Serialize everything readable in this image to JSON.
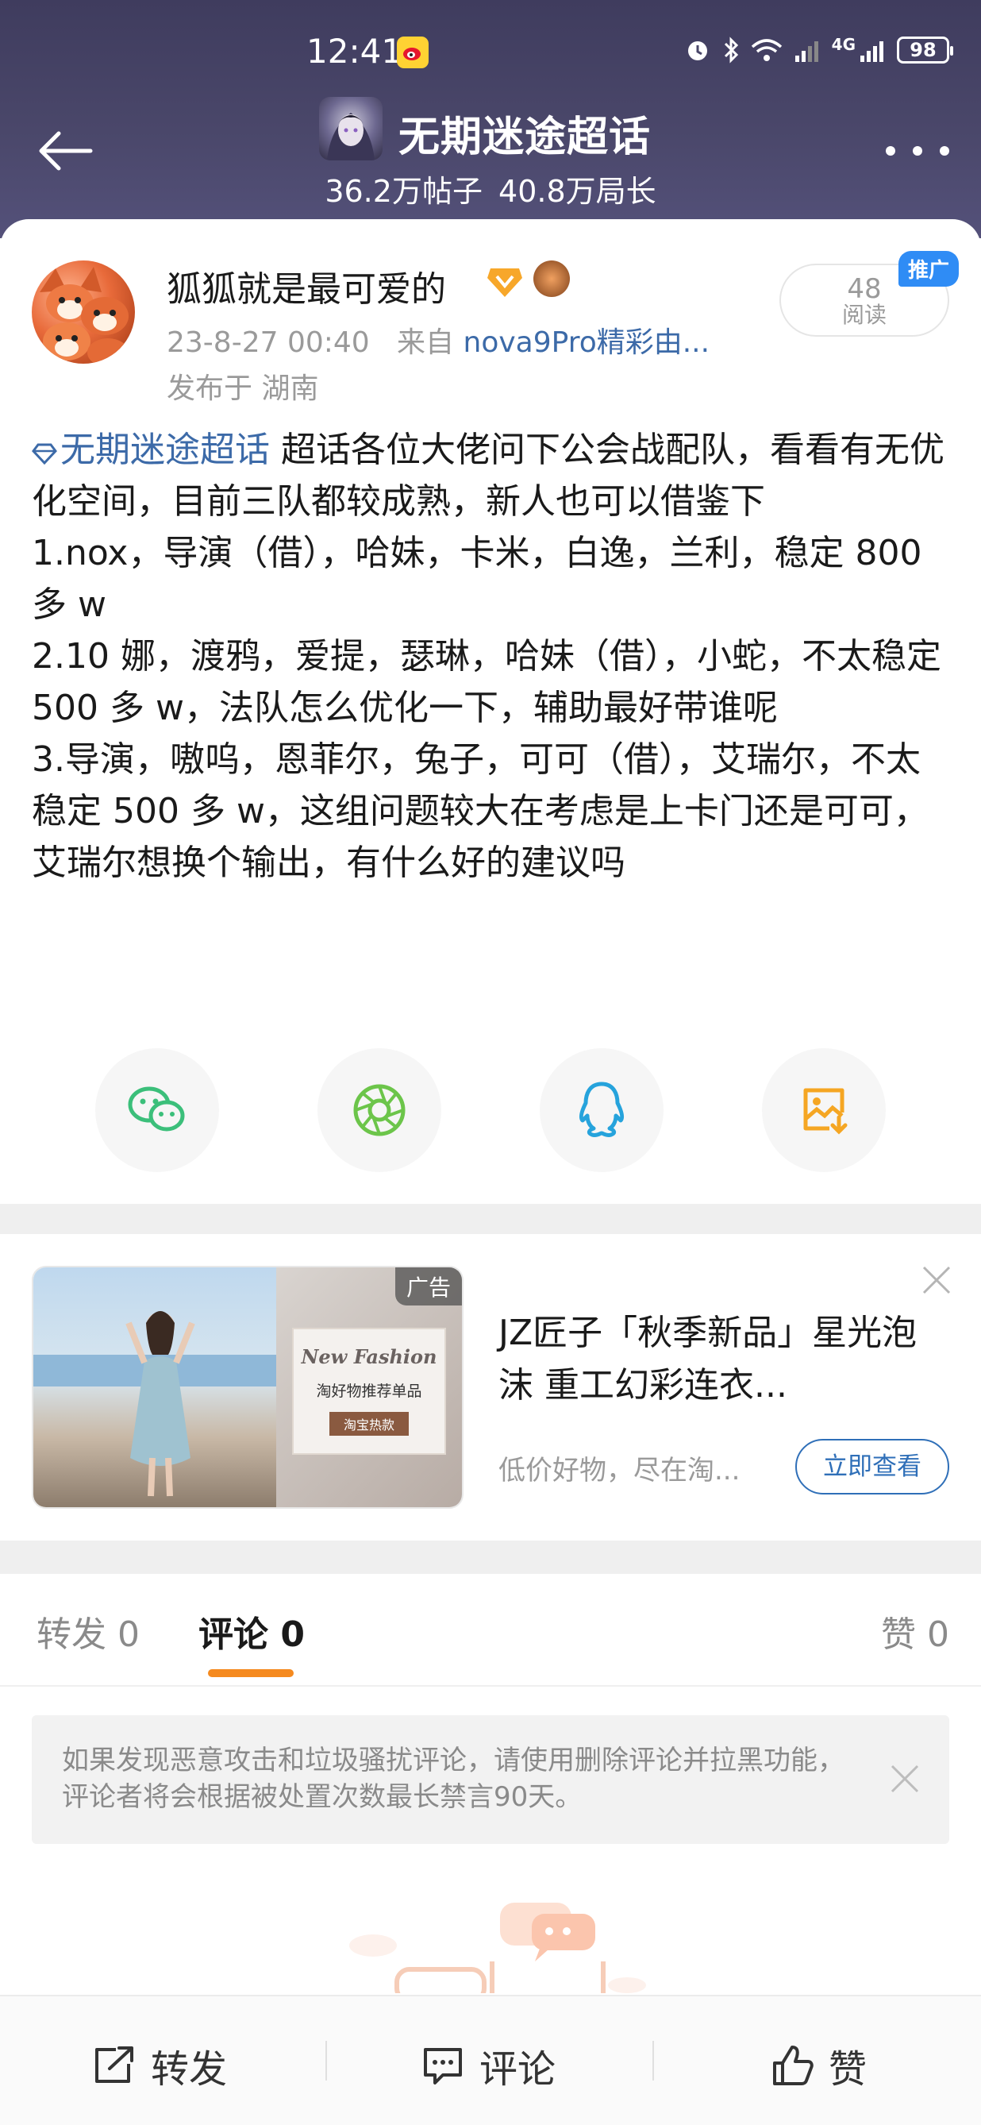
{
  "status_bar": {
    "time": "12:41",
    "battery": "98",
    "network": "4G"
  },
  "header": {
    "title": "无期迷途超话",
    "posts": "36.2万帖子",
    "members": "40.8万局长"
  },
  "post": {
    "author": "狐狐就是最可爱的",
    "date": "23-8-27 00:40",
    "source_prefix": "来自",
    "source": "nova9Pro精彩由...",
    "location": "发布于 湖南",
    "read_count": "48",
    "read_label": "阅读",
    "promo_tag": "推广",
    "topic_link": "无期迷途超话",
    "intro": "超话各位大佬问下公会战配队，看看有无优化空间，目前三队都较成熟，新人也可以借鉴下",
    "line1": "1.nox，导演（借），哈妹，卡米，白逸，兰利，稳定 800 多 w",
    "line2": "2.10 娜，渡鸦，爱提，瑟琳，哈妹（借），小蛇，不太稳定 500 多 w，法队怎么优化一下，辅助最好带谁呢",
    "line3": "3.导演，嗷呜，恩菲尔，兔子，可可（借），艾瑞尔，不太稳定 500 多 w，这组问题较大在考虑是上卡门还是可可，艾瑞尔想换个输出，有什么好的建议吗"
  },
  "ad": {
    "label": "广告",
    "image_brand": "New Fashion",
    "image_caption": "淘好物推荐单品",
    "image_tag": "淘宝热款",
    "title": "JZ匠子「秋季新品」星光泡沫 重工幻彩连衣...",
    "desc": "低价好物，尽在淘...",
    "cta": "立即查看"
  },
  "tabs": {
    "repost": "转发 0",
    "comment": "评论 0",
    "like": "赞 0"
  },
  "notice": "如果发现恶意攻击和垃圾骚扰评论，请使用删除评论并拉黑功能，评论者将会根据被处置次数最长禁言90天。",
  "bottom_bar": {
    "repost": "转发",
    "comment": "评论",
    "like": "赞"
  },
  "colors": {
    "header_bg": "#4a476a",
    "link": "#3c6aa8",
    "accent": "#f58a1f",
    "promo": "#2f8cf5"
  }
}
